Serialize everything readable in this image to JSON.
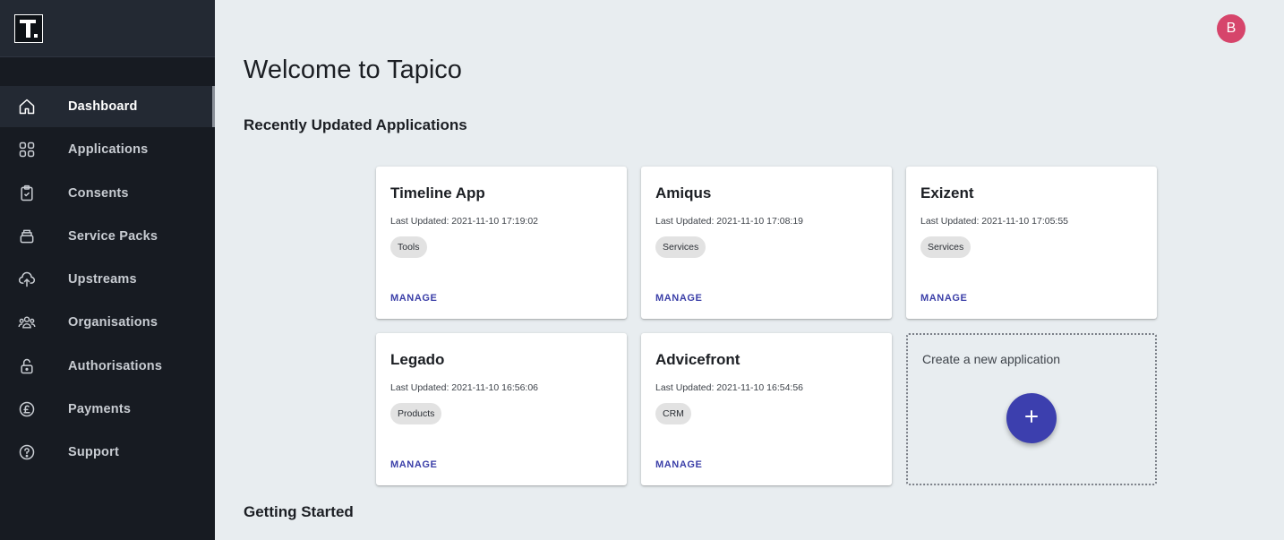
{
  "app": {
    "logo_icon": "tapico-logo",
    "avatar_initial": "B"
  },
  "sidebar": {
    "items": [
      {
        "label": "Dashboard",
        "icon": "home-icon",
        "active": true
      },
      {
        "label": "Applications",
        "icon": "grid-icon"
      },
      {
        "label": "Consents",
        "icon": "clipboard-check-icon"
      },
      {
        "label": "Service Packs",
        "icon": "stack-icon"
      },
      {
        "label": "Upstreams",
        "icon": "cloud-upload-icon"
      },
      {
        "label": "Organisations",
        "icon": "people-icon"
      },
      {
        "label": "Authorisations",
        "icon": "lock-icon"
      },
      {
        "label": "Payments",
        "icon": "pound-icon"
      },
      {
        "label": "Support",
        "icon": "help-icon"
      }
    ]
  },
  "main": {
    "title": "Welcome to Tapico",
    "recent_heading": "Recently Updated Applications",
    "getting_started_heading": "Getting Started",
    "cards": [
      {
        "name": "Timeline App",
        "updated": "Last Updated: 2021-11-10 17:19:02",
        "tag": "Tools",
        "action": "MANAGE"
      },
      {
        "name": "Amiqus",
        "updated": "Last Updated: 2021-11-10 17:08:19",
        "tag": "Services",
        "action": "MANAGE"
      },
      {
        "name": "Exizent",
        "updated": "Last Updated: 2021-11-10 17:05:55",
        "tag": "Services",
        "action": "MANAGE"
      },
      {
        "name": "Legado",
        "updated": "Last Updated: 2021-11-10 16:56:06",
        "tag": "Products",
        "action": "MANAGE"
      },
      {
        "name": "Advicefront",
        "updated": "Last Updated: 2021-11-10 16:54:56",
        "tag": "CRM",
        "action": "MANAGE"
      }
    ],
    "new_app": {
      "label": "Create a new application",
      "button_icon": "plus-icon"
    }
  },
  "colors": {
    "accent": "#3c3fae",
    "avatar": "#d6456b",
    "sidebar": "#171b22"
  }
}
